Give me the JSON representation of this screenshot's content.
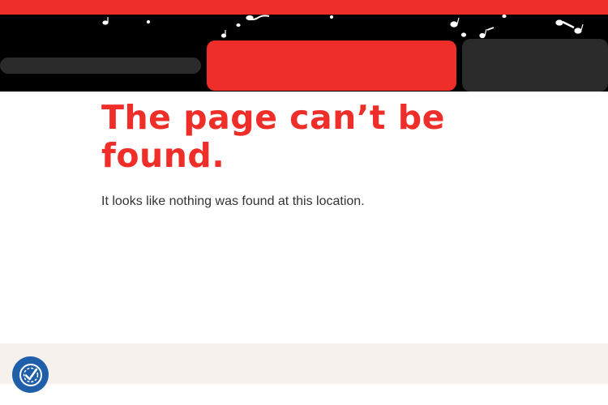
{
  "colors": {
    "accent": "#ef2e2a",
    "header_bg": "#000000",
    "footer_bg": "#f6f1ec",
    "a11y_bg": "#1f5ea8"
  },
  "error": {
    "title": "The page can’t be found.",
    "message": "It looks like nothing was found at this location."
  },
  "header": {
    "decoration": "music-notes",
    "search_icon": "search-bar",
    "nav_primary_icon": "nav-button",
    "nav_secondary_icon": "nav-button"
  },
  "accessibility": {
    "icon": "accessibility-check-icon"
  }
}
